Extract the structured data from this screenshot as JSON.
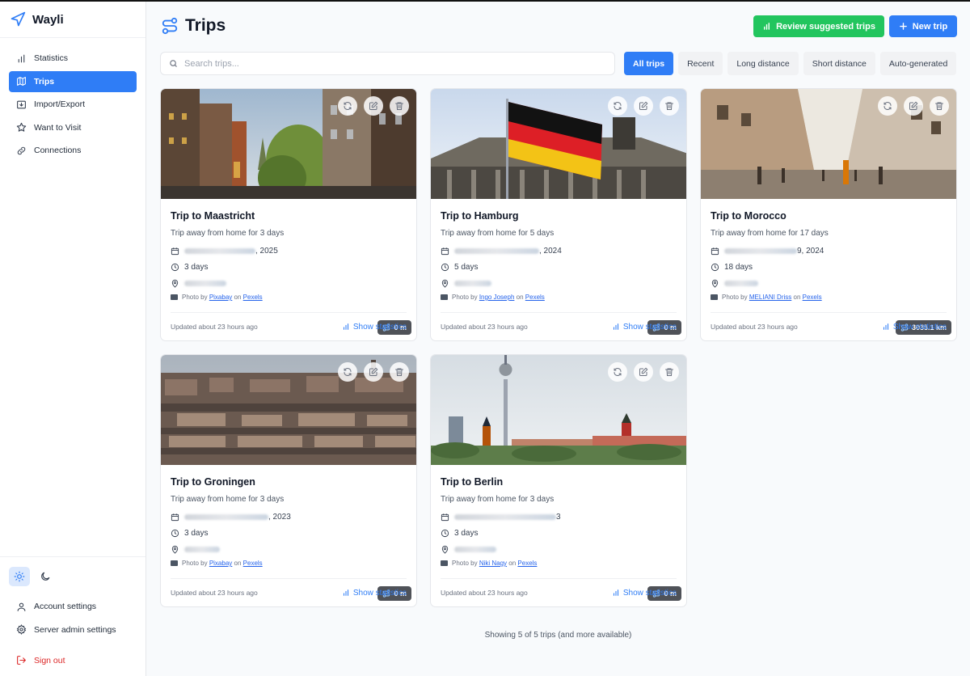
{
  "app": {
    "name": "Wayli"
  },
  "sidebar": {
    "items": [
      {
        "label": "Statistics",
        "icon": "bar-chart-icon",
        "active": false
      },
      {
        "label": "Trips",
        "icon": "map-icon",
        "active": true
      },
      {
        "label": "Import/Export",
        "icon": "download-icon",
        "active": false
      },
      {
        "label": "Want to Visit",
        "icon": "star-icon",
        "active": false
      },
      {
        "label": "Connections",
        "icon": "link-icon",
        "active": false
      }
    ],
    "bottom": {
      "account": "Account settings",
      "admin": "Server admin settings",
      "signout": "Sign out"
    }
  },
  "header": {
    "title": "Trips",
    "review_label": "Review suggested trips",
    "new_label": "New trip"
  },
  "search": {
    "placeholder": "Search trips..."
  },
  "filters": [
    "All trips",
    "Recent",
    "Long distance",
    "Short distance",
    "Auto-generated"
  ],
  "cards": [
    {
      "title": "Trip to Maastricht",
      "desc": "Trip away from home for 3 days",
      "date_end": ", 2025",
      "duration": "3 days",
      "distance": "0 m",
      "photographer": "Pixabay",
      "source": "Pexels",
      "updated": "Updated about 23 hours ago",
      "stats": "Show statistics"
    },
    {
      "title": "Trip to Hamburg",
      "desc": "Trip away from home for 5 days",
      "date_end": ", 2024",
      "duration": "5 days",
      "distance": "0 m",
      "photographer": "Ingo Joseph",
      "source": "Pexels",
      "updated": "Updated about 23 hours ago",
      "stats": "Show statistics"
    },
    {
      "title": "Trip to Morocco",
      "desc": "Trip away from home for 17 days",
      "date_end": "9, 2024",
      "duration": "18 days",
      "distance": "3035.1 km",
      "photographer": "MELIANI Driss",
      "source": "Pexels",
      "updated": "Updated about 23 hours ago",
      "stats": "Show statistics"
    },
    {
      "title": "Trip to Groningen",
      "desc": "Trip away from home for 3 days",
      "date_end": ", 2023",
      "duration": "3 days",
      "distance": "0 m",
      "photographer": "Pixabay",
      "source": "Pexels",
      "updated": "Updated about 23 hours ago",
      "stats": "Show statistics"
    },
    {
      "title": "Trip to Berlin",
      "desc": "Trip away from home for 3 days",
      "date_end": "3",
      "duration": "3 days",
      "distance": "0 m",
      "photographer": "Niki Nagy",
      "source": "Pexels",
      "updated": "Updated about 23 hours ago",
      "stats": "Show statistics"
    }
  ],
  "credit": {
    "prefix": "Photo by",
    "on": "on"
  },
  "footer": {
    "showing": "Showing 5 of 5 trips (and more available)"
  },
  "colors": {
    "accent": "#2f7df6",
    "success": "#22c55e",
    "danger": "#dc2626"
  }
}
